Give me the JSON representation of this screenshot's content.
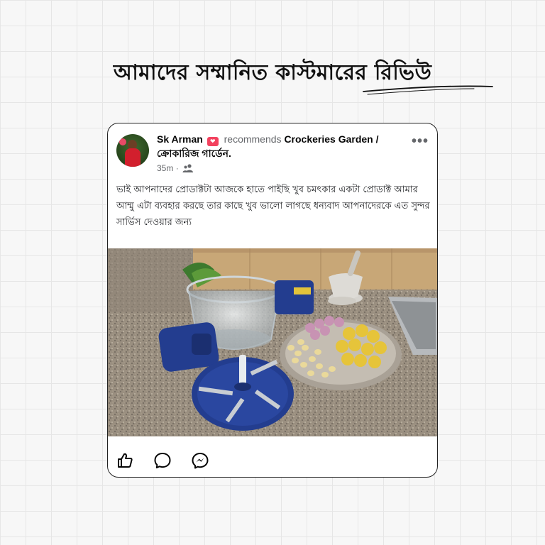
{
  "headline": "আমাদের সম্মানিত কাস্টমারের রিভিউ",
  "post": {
    "author": "Sk Arman",
    "action_text": "recommends",
    "page_name": "Crockeries Garden / ক্রোকারিজ গার্ডেন",
    "page_name_suffix": ".",
    "time": "35m",
    "dot": "·",
    "audience_icon": "friends-icon",
    "more_label": "•••",
    "body": "ভাই আপনাদের প্রোডাক্টটা আজকে হাতে পাইছি খুব চমৎকার একটা প্রোডাক্ট আমার আম্মু এটা ব্যবহার করছে তার কাছে খুব ভালো লাগছে ধন্যবাদ আপনাদেরকে এত সুন্দর সার্ভিস দেওয়ার জন্য",
    "photo_icon": "chopper-product-photo",
    "actions": [
      {
        "icon": "like-icon"
      },
      {
        "icon": "comment-icon"
      },
      {
        "icon": "messenger-icon"
      }
    ]
  },
  "colors": {
    "card_border": "#222222",
    "recommend_badge": "#f3425f",
    "secondary_text": "#65676b",
    "product_blue": "#233d8f"
  }
}
